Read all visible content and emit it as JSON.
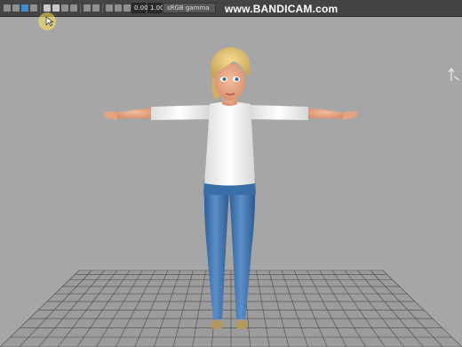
{
  "toolbar": {
    "field_1": "0.00",
    "field_2": "1.00",
    "color_space": "sRGB gamma"
  },
  "watermark": "www.BANDICAM.com",
  "viewport": {
    "icons": [
      "view-axis-icon"
    ]
  },
  "colors": {
    "viewport_bg": "#a6a6a6",
    "toolbar_bg": "#444444",
    "accent": "#3f8fd6",
    "shirt": "#f0f0f0",
    "jeans": "#3a6ea8",
    "hair": "#e0c070",
    "skin": "#e8a585"
  }
}
